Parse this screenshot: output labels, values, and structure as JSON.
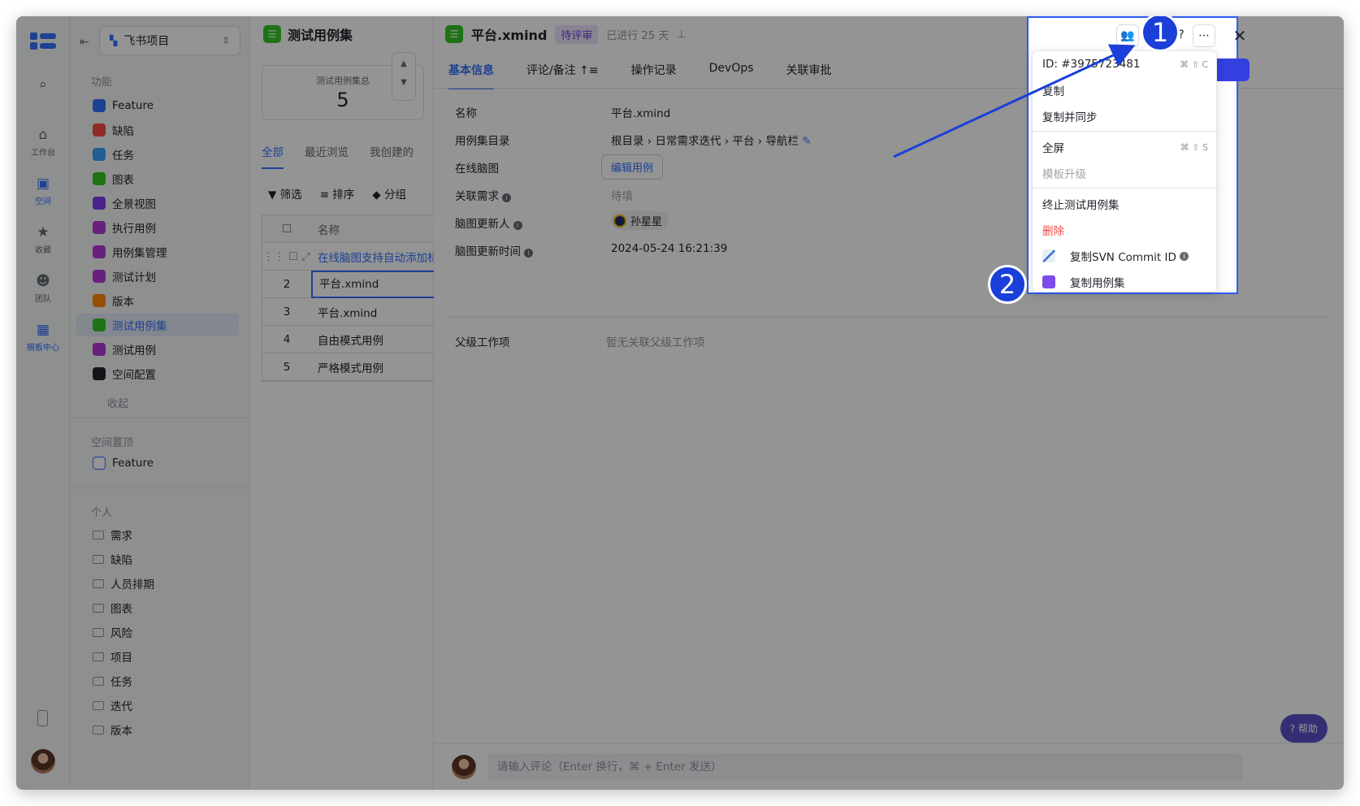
{
  "rail": {
    "items": [
      {
        "label": "",
        "icon": "search-icon"
      },
      {
        "label": "工作台",
        "icon": "home-icon"
      },
      {
        "label": "空间",
        "icon": "space-icon"
      },
      {
        "label": "收藏",
        "icon": "star-icon"
      },
      {
        "label": "团队",
        "icon": "team-icon"
      },
      {
        "label": "模板中心",
        "icon": "template-icon"
      }
    ]
  },
  "nav": {
    "project": "飞书项目",
    "section_features": "功能",
    "items": [
      "Feature",
      "缺陷",
      "任务",
      "图表",
      "全景视图",
      "执行用例",
      "用例集管理",
      "测试计划",
      "版本",
      "测试用例集",
      "测试用例",
      "空间配置"
    ],
    "collapse": "收起",
    "section_pinned": "空间置顶",
    "pinned": [
      "Feature"
    ],
    "section_personal": "个人",
    "personal": [
      "需求",
      "缺陷",
      "人员排期",
      "图表",
      "风险",
      "项目",
      "任务",
      "迭代",
      "版本"
    ]
  },
  "list": {
    "title": "测试用例集",
    "stat_label": "测试用例集总",
    "stat_value": "5",
    "tabs": [
      "全部",
      "最近浏览",
      "我创建的"
    ],
    "toolbar": [
      "筛选",
      "排序",
      "分组"
    ],
    "column": "名称",
    "rows": [
      {
        "idx": "",
        "name": "在线脑图支持自动添加标"
      },
      {
        "idx": "2",
        "name": "平台.xmind"
      },
      {
        "idx": "3",
        "name": "平台.xmind"
      },
      {
        "idx": "4",
        "name": "自由模式用例"
      },
      {
        "idx": "5",
        "name": "严格模式用例"
      }
    ]
  },
  "detail": {
    "title": "平台.xmind",
    "status": "待评审",
    "elapsed": "已进行 25 天",
    "tabs": [
      "基本信息",
      "评论/备注",
      "操作记录",
      "DevOps",
      "关联审批"
    ],
    "fields": {
      "name_label": "名称",
      "name_value": "平台.xmind",
      "dir_label": "用例集目录",
      "dir_value": "根目录 › 日常需求迭代 › 平台 › 导航栏",
      "mindmap_label": "在线脑图",
      "mindmap_btn": "编辑用例",
      "req_label": "关联需求",
      "req_value": "待填",
      "updater_label": "脑图更新人",
      "updater_value": "孙星星",
      "time_label": "脑图更新时间",
      "time_value": "2024-05-24 16:21:39",
      "parent_label": "父级工作项",
      "parent_value": "暂无关联父级工作项"
    },
    "comment_placeholder": "请输入评论（Enter 换行，⌘ + Enter 发送）",
    "help": "帮助"
  },
  "menu": {
    "id_text": "ID: #3975723481",
    "id_shortcut": "⌘ ⇧ C",
    "copy": "复制",
    "copy_sync": "复制并同步",
    "fullscreen": "全屏",
    "fullscreen_shortcut": "⌘ ⇧ S",
    "template_upgrade": "模板升级",
    "terminate": "终止测试用例集",
    "delete": "删除",
    "copy_svn": "复制SVN Commit ID",
    "copy_caseset": "复制用例集"
  },
  "annotations": [
    "1",
    "2"
  ],
  "colors": {
    "accent": "#3370ff",
    "annotation": "#1b3fd9",
    "danger": "#f54a45",
    "status": "#6d3fd5"
  }
}
